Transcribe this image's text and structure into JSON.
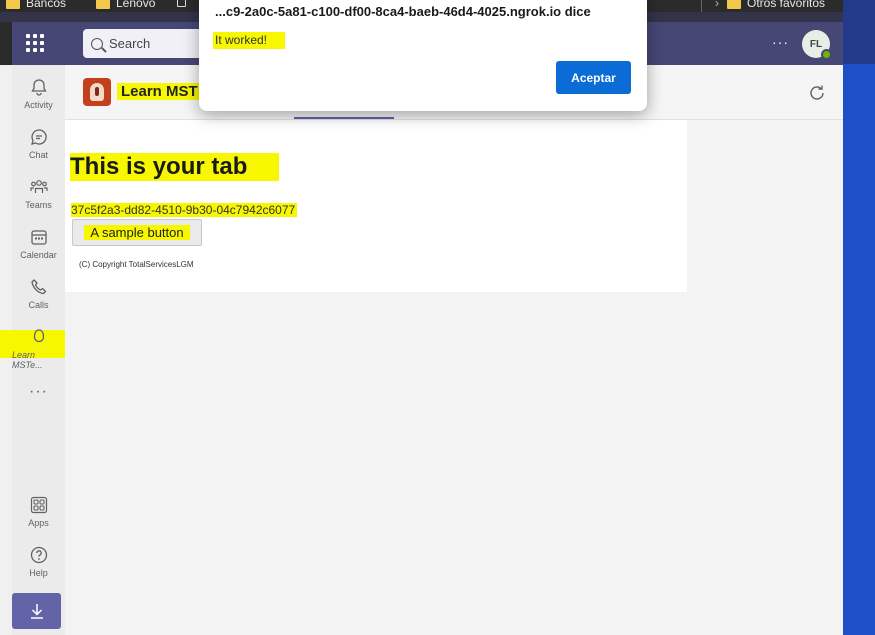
{
  "bookmarks": {
    "items": [
      {
        "label": "Bancos",
        "icon": "folder-icon"
      },
      {
        "label": "Lenovo",
        "icon": "folder-icon"
      }
    ],
    "other_favorites": "Otros favoritos"
  },
  "topbar": {
    "search_placeholder": "Search",
    "more_label": "···",
    "avatar_initials": "FL"
  },
  "rail": {
    "items": [
      {
        "label": "Activity",
        "icon": "bell-icon"
      },
      {
        "label": "Chat",
        "icon": "chat-icon"
      },
      {
        "label": "Teams",
        "icon": "teams-icon"
      },
      {
        "label": "Calendar",
        "icon": "calendar-icon"
      },
      {
        "label": "Calls",
        "icon": "phone-icon"
      },
      {
        "label": "Learn MSTe...",
        "icon": "app-icon"
      }
    ],
    "more_label": "···",
    "bottom_items": [
      {
        "label": "Apps",
        "icon": "apps-icon"
      },
      {
        "label": "Help",
        "icon": "help-icon"
      }
    ]
  },
  "app_header": {
    "title": "Learn MST"
  },
  "tab": {
    "heading": "This is your tab",
    "guid": "37c5f2a3-dd82-4510-9b30-04c7942c6077",
    "button_label": "A sample button",
    "copyright": "(C) Copyright TotalServicesLGM"
  },
  "dialog": {
    "title": "...c9-2a0c-5a81-c100-df00-8ca4-baeb-46d4-4025.ngrok.io dice",
    "message": "It worked!",
    "accept_label": "Aceptar"
  },
  "colors": {
    "teams_purple": "#464775",
    "accent": "#6264a7",
    "highlight": "#f7f700",
    "accept_blue": "#0b6cd6"
  }
}
